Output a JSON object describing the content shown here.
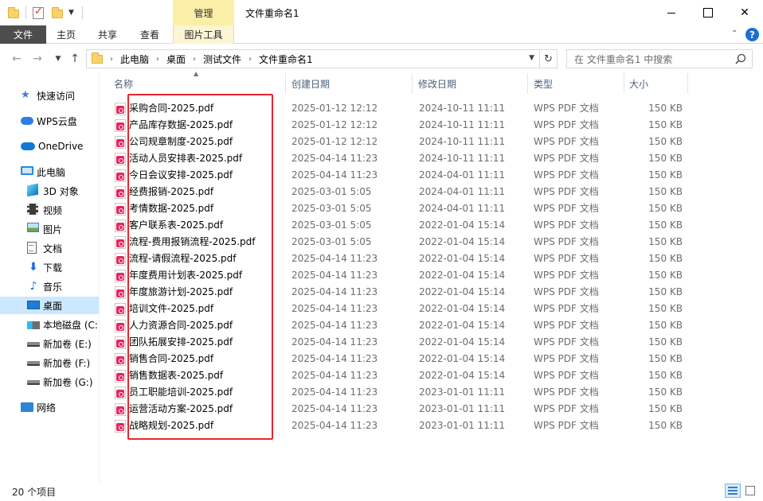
{
  "window": {
    "title": "文件重命名1",
    "context_group": "管理",
    "controls": {
      "minimize": "minimize",
      "maximize": "maximize",
      "close": "✕"
    }
  },
  "ribbon": {
    "tabs": [
      "文件",
      "主页",
      "共享",
      "查看",
      "图片工具"
    ]
  },
  "nav": {
    "breadcrumbs": [
      "此电脑",
      "桌面",
      "测试文件",
      "文件重命名1"
    ],
    "search_placeholder": "在 文件重命名1 中搜索"
  },
  "sidebar": {
    "items": [
      {
        "label": "快速访问",
        "icon": "pin-icon"
      },
      {
        "label": "WPS云盘",
        "icon": "wps-cloud-icon"
      },
      {
        "label": "OneDrive",
        "icon": "onedrive-icon"
      },
      {
        "label": "此电脑",
        "icon": "this-pc-icon"
      },
      {
        "label": "3D 对象",
        "icon": "3d-objects-icon"
      },
      {
        "label": "视频",
        "icon": "video-icon"
      },
      {
        "label": "图片",
        "icon": "pictures-icon"
      },
      {
        "label": "文档",
        "icon": "documents-icon"
      },
      {
        "label": "下载",
        "icon": "download-icon"
      },
      {
        "label": "音乐",
        "icon": "music-icon"
      },
      {
        "label": "桌面",
        "icon": "desktop-icon",
        "selected": true
      },
      {
        "label": "本地磁盘 (C:",
        "icon": "local-disk-icon"
      },
      {
        "label": "新加卷 (E:)",
        "icon": "drive-icon"
      },
      {
        "label": "新加卷 (F:)",
        "icon": "drive-icon"
      },
      {
        "label": "新加卷 (G:)",
        "icon": "drive-icon"
      },
      {
        "label": "网络",
        "icon": "network-icon"
      }
    ]
  },
  "columns": {
    "name": "名称",
    "created": "创建日期",
    "modified": "修改日期",
    "type": "类型",
    "size": "大小"
  },
  "files": [
    {
      "name": "采购合同-2025.pdf",
      "created": "2025-01-12 12:12",
      "modified": "2024-10-11 11:11",
      "type": "WPS PDF 文档",
      "size": "150 KB"
    },
    {
      "name": "产品库存数据-2025.pdf",
      "created": "2025-01-12 12:12",
      "modified": "2024-10-11 11:11",
      "type": "WPS PDF 文档",
      "size": "150 KB"
    },
    {
      "name": "公司规章制度-2025.pdf",
      "created": "2025-01-12 12:12",
      "modified": "2024-10-11 11:11",
      "type": "WPS PDF 文档",
      "size": "150 KB"
    },
    {
      "name": "活动人员安排表-2025.pdf",
      "created": "2025-04-14 11:23",
      "modified": "2024-10-11 11:11",
      "type": "WPS PDF 文档",
      "size": "150 KB"
    },
    {
      "name": "今日会议安排-2025.pdf",
      "created": "2025-04-14 11:23",
      "modified": "2024-04-01 11:11",
      "type": "WPS PDF 文档",
      "size": "150 KB"
    },
    {
      "name": "经费报销-2025.pdf",
      "created": "2025-03-01 5:05",
      "modified": "2024-04-01 11:11",
      "type": "WPS PDF 文档",
      "size": "150 KB"
    },
    {
      "name": "考情数据-2025.pdf",
      "created": "2025-03-01 5:05",
      "modified": "2024-04-01 11:11",
      "type": "WPS PDF 文档",
      "size": "150 KB"
    },
    {
      "name": "客户联系表-2025.pdf",
      "created": "2025-03-01 5:05",
      "modified": "2022-01-04 15:14",
      "type": "WPS PDF 文档",
      "size": "150 KB"
    },
    {
      "name": "流程-费用报销流程-2025.pdf",
      "created": "2025-03-01 5:05",
      "modified": "2022-01-04 15:14",
      "type": "WPS PDF 文档",
      "size": "150 KB"
    },
    {
      "name": "流程-请假流程-2025.pdf",
      "created": "2025-04-14 11:23",
      "modified": "2022-01-04 15:14",
      "type": "WPS PDF 文档",
      "size": "150 KB"
    },
    {
      "name": "年度费用计划表-2025.pdf",
      "created": "2025-04-14 11:23",
      "modified": "2022-01-04 15:14",
      "type": "WPS PDF 文档",
      "size": "150 KB"
    },
    {
      "name": "年度旅游计划-2025.pdf",
      "created": "2025-04-14 11:23",
      "modified": "2022-01-04 15:14",
      "type": "WPS PDF 文档",
      "size": "150 KB"
    },
    {
      "name": "培训文件-2025.pdf",
      "created": "2025-04-14 11:23",
      "modified": "2022-01-04 15:14",
      "type": "WPS PDF 文档",
      "size": "150 KB"
    },
    {
      "name": "人力资源合同-2025.pdf",
      "created": "2025-04-14 11:23",
      "modified": "2022-01-04 15:14",
      "type": "WPS PDF 文档",
      "size": "150 KB"
    },
    {
      "name": "团队拓展安排-2025.pdf",
      "created": "2025-04-14 11:23",
      "modified": "2022-01-04 15:14",
      "type": "WPS PDF 文档",
      "size": "150 KB"
    },
    {
      "name": "销售合同-2025.pdf",
      "created": "2025-04-14 11:23",
      "modified": "2022-01-04 15:14",
      "type": "WPS PDF 文档",
      "size": "150 KB"
    },
    {
      "name": "销售数据表-2025.pdf",
      "created": "2025-04-14 11:23",
      "modified": "2022-01-04 15:14",
      "type": "WPS PDF 文档",
      "size": "150 KB"
    },
    {
      "name": "员工职能培训-2025.pdf",
      "created": "2025-04-14 11:23",
      "modified": "2023-01-01 11:11",
      "type": "WPS PDF 文档",
      "size": "150 KB"
    },
    {
      "name": "运营活动方案-2025.pdf",
      "created": "2025-04-14 11:23",
      "modified": "2023-01-01 11:11",
      "type": "WPS PDF 文档",
      "size": "150 KB"
    },
    {
      "name": "战略规划-2025.pdf",
      "created": "2025-04-14 11:23",
      "modified": "2023-01-01 11:11",
      "type": "WPS PDF 文档",
      "size": "150 KB"
    }
  ],
  "status": {
    "item_count": "20 个项目"
  },
  "colors": {
    "selected_bg": "#cce8ff",
    "file_tab_bg": "#4d4d4d",
    "context_tab_bg": "#fbefa8",
    "highlight_border": "#e8262c",
    "header_text": "#4c607a"
  }
}
